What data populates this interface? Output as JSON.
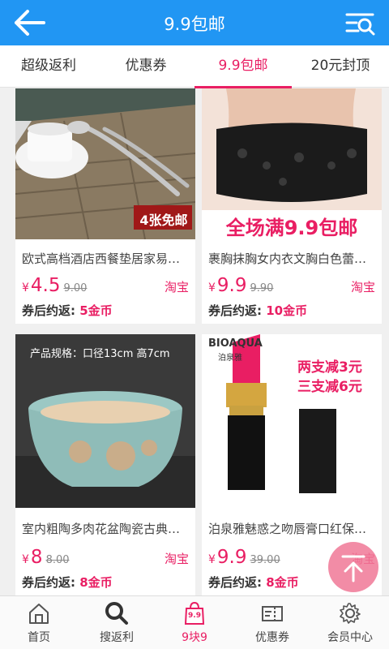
{
  "appbar": {
    "title": "9.9包邮"
  },
  "tabs": [
    {
      "label": "超级返利"
    },
    {
      "label": "优惠券"
    },
    {
      "label": "9.9包邮"
    },
    {
      "label": "20元封顶"
    }
  ],
  "products": [
    {
      "name": "欧式高档酒店西餐垫居家易洁防烫隔热餐垫",
      "yen": "¥",
      "price": "4.5",
      "orig": "9.00",
      "store": "淘宝",
      "rebate_label": "券后约返:",
      "rebate_amount": "5金币",
      "badge": "4张免邮"
    },
    {
      "name": "裹胸抹胸女内衣文胸白色蕾丝打底",
      "yen": "¥",
      "price": "9.9",
      "orig": "9.90",
      "store": "淘宝",
      "rebate_label": "券后约返:",
      "rebate_amount": "10金币",
      "banner": "全场满9.9包邮"
    },
    {
      "name": "室内粗陶多肉花盆陶瓷古典花盆",
      "yen": "¥",
      "price": "8",
      "orig": "8.00",
      "store": "淘宝",
      "rebate_label": "券后约返:",
      "rebate_amount": "8金币",
      "spec": "产品规格：口径13cm  高7cm"
    },
    {
      "name": "泊泉雅魅惑之吻唇膏口红保湿滋润",
      "yen": "¥",
      "price": "9.9",
      "orig": "39.00",
      "store": "淘宝",
      "rebate_label": "券后约返:",
      "rebate_amount": "8金币",
      "brand": "BIOAQUA",
      "brand_cn": "泊泉雅",
      "promo1": "两支减3元",
      "promo2": "三支减6元"
    }
  ],
  "bottomnav": [
    {
      "label": "首页"
    },
    {
      "label": "搜返利"
    },
    {
      "label": "9块9",
      "badge": "9.9"
    },
    {
      "label": "优惠券"
    },
    {
      "label": "会员中心"
    }
  ],
  "colors": {
    "primary": "#2196f3",
    "accent": "#e91e63"
  }
}
